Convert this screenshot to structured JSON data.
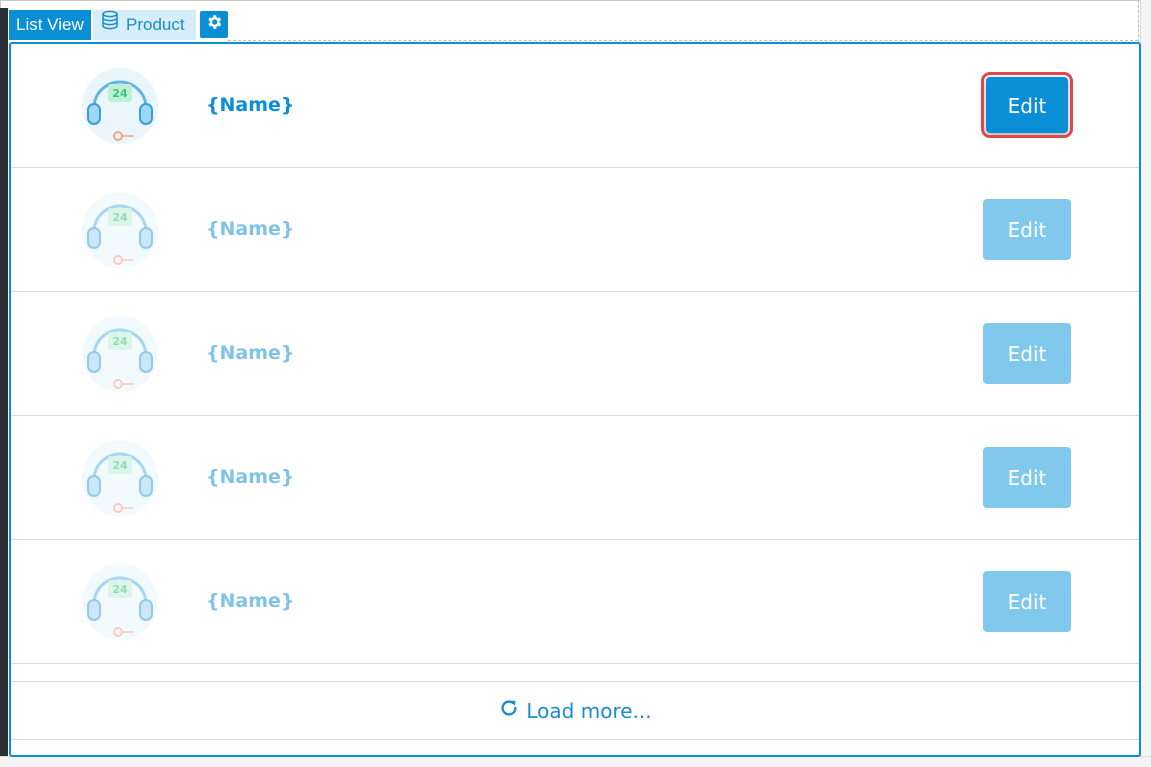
{
  "toolbar": {
    "list_view_label": "List View",
    "datasource_label": "Product",
    "datasource_icon": "database-icon",
    "settings_icon": "gear-icon"
  },
  "list": {
    "rows": [
      {
        "name": "{Name}",
        "edit_label": "Edit",
        "avatar_badge": "24",
        "state": "active"
      },
      {
        "name": "{Name}",
        "edit_label": "Edit",
        "avatar_badge": "24",
        "state": "placeholder"
      },
      {
        "name": "{Name}",
        "edit_label": "Edit",
        "avatar_badge": "24",
        "state": "placeholder"
      },
      {
        "name": "{Name}",
        "edit_label": "Edit",
        "avatar_badge": "24",
        "state": "placeholder"
      },
      {
        "name": "{Name}",
        "edit_label": "Edit",
        "avatar_badge": "24",
        "state": "placeholder"
      }
    ],
    "load_more_label": "Load more...",
    "load_more_icon": "refresh-icon"
  },
  "colors": {
    "accent": "#0a8fd6",
    "accent_faded": "#80c8ec",
    "highlight_outline": "#e0474c"
  }
}
